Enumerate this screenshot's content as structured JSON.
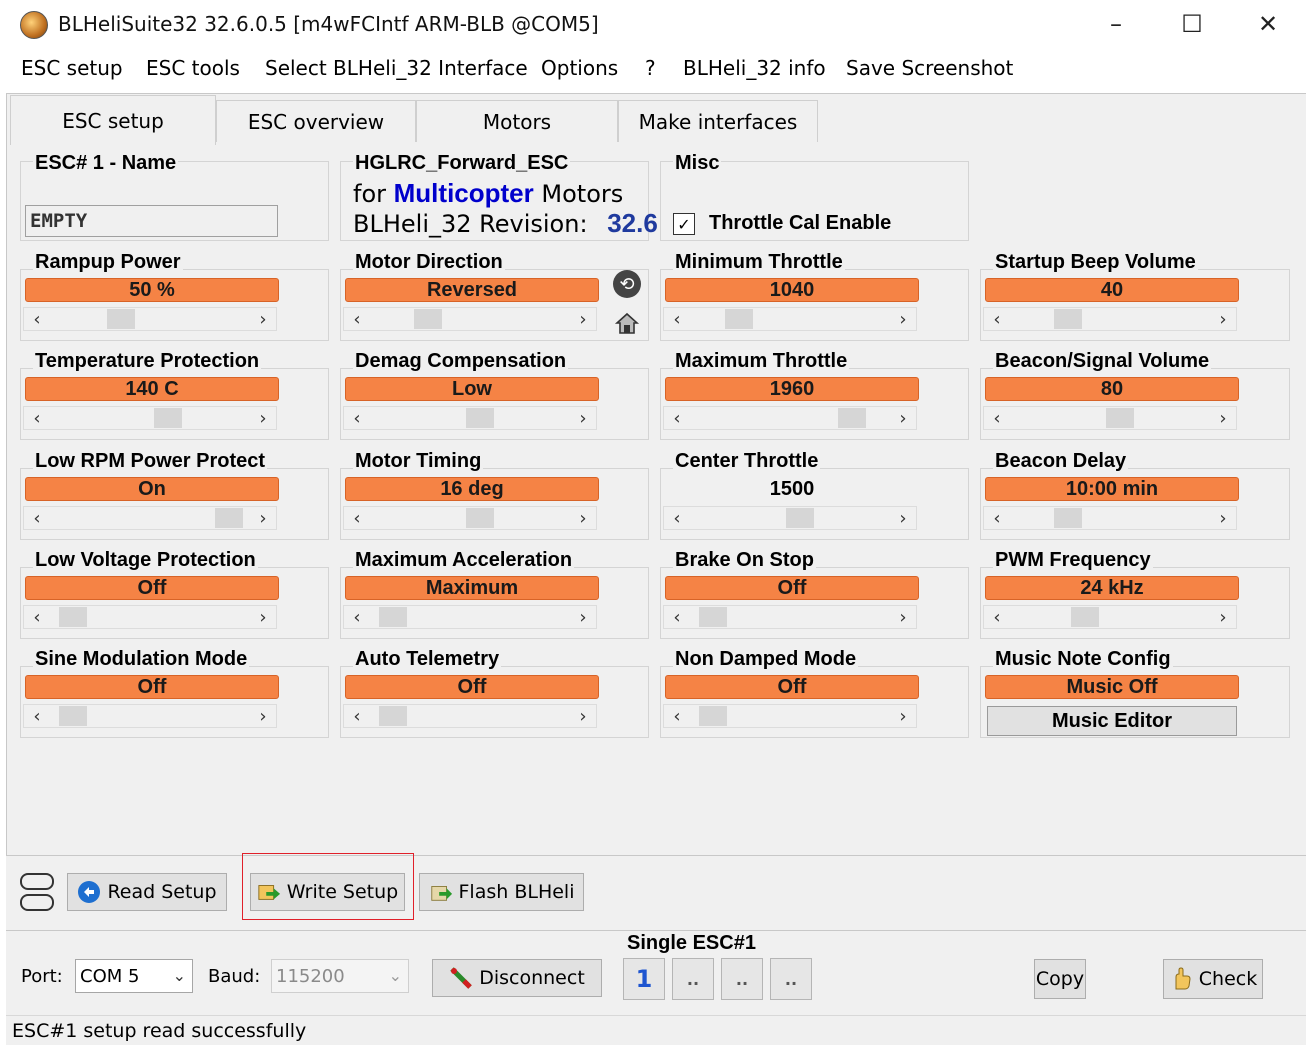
{
  "window": {
    "title": "BLHeliSuite32 32.6.0.5  [m4wFCIntf ARM-BLB @COM5]",
    "minimize_glyph": "–",
    "maximize_glyph": "☐",
    "close_glyph": "✕"
  },
  "menu": [
    "ESC setup",
    "ESC tools",
    "Select BLHeli_32 Interface",
    "Options",
    "?",
    "BLHeli_32 info",
    "Save Screenshot"
  ],
  "tabs": [
    "ESC setup",
    "ESC overview",
    "Motors",
    "Make interfaces"
  ],
  "esc_name": {
    "label": "ESC# 1 - Name",
    "value": "EMPTY"
  },
  "esc_info": {
    "model": "HGLRC_Forward_ESC",
    "for_prefix": "for",
    "type": "Multicopter",
    "for_suffix": "Motors",
    "revision_label": "BLHeli_32 Revision:",
    "revision": "32.6"
  },
  "misc": {
    "label": "Misc",
    "throttle_cal_label": "Throttle Cal Enable",
    "throttle_cal_checked": true,
    "check_glyph": "✓"
  },
  "params": {
    "rampup_power": {
      "label": "Rampup Power",
      "value": "50 %",
      "level": 0.33
    },
    "motor_direction": {
      "label": "Motor Direction",
      "value": "Reversed",
      "level": 0.25
    },
    "min_throttle": {
      "label": "Minimum Throttle",
      "value": "1040",
      "level": 0.2
    },
    "startup_beep": {
      "label": "Startup Beep Volume",
      "value": "40",
      "level": 0.25
    },
    "temp_protection": {
      "label": "Temperature Protection",
      "value": "140 C",
      "level": 0.6
    },
    "demag": {
      "label": "Demag Compensation",
      "value": "Low",
      "level": 0.55
    },
    "max_throttle": {
      "label": "Maximum Throttle",
      "value": "1960",
      "level": 0.85
    },
    "beacon_volume": {
      "label": "Beacon/Signal Volume",
      "value": "80",
      "level": 0.55
    },
    "low_rpm_protect": {
      "label": "Low RPM Power Protect",
      "value": "On",
      "level": 0.95
    },
    "motor_timing": {
      "label": "Motor Timing",
      "value": "16 deg",
      "level": 0.55
    },
    "center_throttle": {
      "label": "Center Throttle",
      "value": "1500",
      "level": 0.55
    },
    "beacon_delay": {
      "label": "Beacon Delay",
      "value": "10:00 min",
      "level": 0.25
    },
    "low_voltage": {
      "label": "Low Voltage Protection",
      "value": "Off",
      "level": 0.05
    },
    "max_accel": {
      "label": "Maximum Acceleration",
      "value": "Maximum",
      "level": 0.05
    },
    "brake_on_stop": {
      "label": "Brake On Stop",
      "value": "Off",
      "level": 0.05
    },
    "pwm_freq": {
      "label": "PWM Frequency",
      "value": "24 kHz",
      "level": 0.35
    },
    "sine_mod": {
      "label": "Sine Modulation Mode",
      "value": "Off",
      "level": 0.05
    },
    "auto_telemetry": {
      "label": "Auto Telemetry",
      "value": "Off",
      "level": 0.05
    },
    "non_damped": {
      "label": "Non Damped Mode",
      "value": "Off",
      "level": 0.05
    },
    "music_note": {
      "label": "Music Note Config",
      "value": "Music Off"
    }
  },
  "music_editor_label": "Music Editor",
  "buttons": {
    "read_setup": "Read Setup",
    "write_setup": "Write Setup",
    "flash": "Flash BLHeli"
  },
  "port": {
    "port_label": "Port:",
    "port_value": "COM 5",
    "baud_label": "Baud:",
    "baud_value": "115200",
    "disconnect": "Disconnect"
  },
  "single_esc": {
    "label": "Single ESC#1",
    "esc_buttons": [
      "1",
      "..",
      "..",
      ".."
    ]
  },
  "copy_label": "Copy",
  "check_label": "Check",
  "status": "ESC#1 setup read successfully",
  "colors": {
    "accent_value": "#f58345",
    "revision_blue": "#1f3a9e",
    "multicopter_blue": "#0000cc",
    "highlight_red": "#e0202a"
  }
}
